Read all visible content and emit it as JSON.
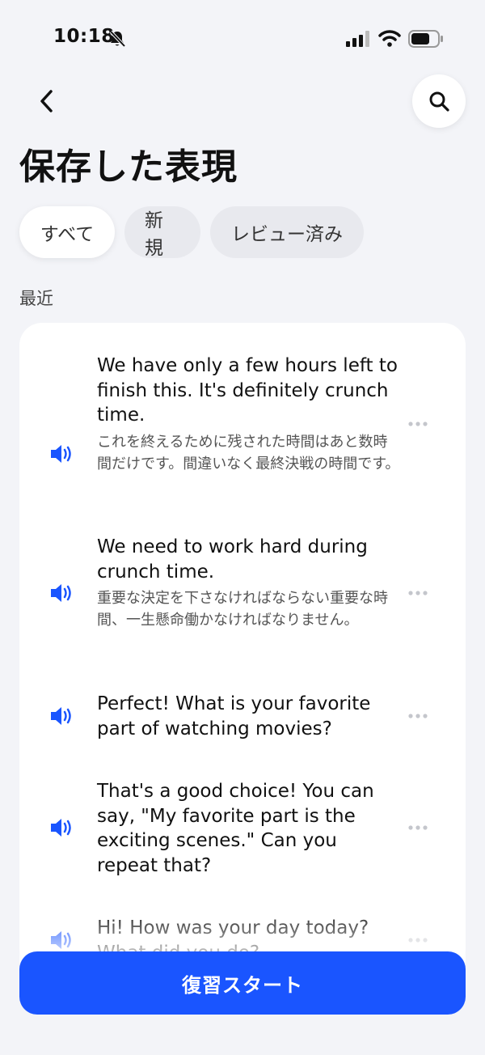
{
  "status_bar": {
    "time": "10:18"
  },
  "header": {
    "title": "保存した表現"
  },
  "tabs": [
    {
      "label": "すべて",
      "active": true
    },
    {
      "label": "新規",
      "active": false
    },
    {
      "label": "レビュー済み",
      "active": false
    }
  ],
  "section": {
    "label": "最近"
  },
  "items": [
    {
      "en": "We have only a few hours left to finish this. It's definitely crunch time.",
      "ja": "これを終えるために残された時間はあと数時間だけです。間違いなく最終決戦の時間です。"
    },
    {
      "en": "We need to work hard during crunch time.",
      "ja": "重要な決定を下さなければならない重要な時間、一生懸命働かなければなりません。"
    },
    {
      "en": "Perfect! What is your favorite part of watching movies?",
      "ja": ""
    },
    {
      "en": "That's a good choice! You can say, \"My favorite part is the exciting scenes.\" Can you repeat that?",
      "ja": ""
    },
    {
      "en": "Hi! How was your day today? What did you do?",
      "ja": ""
    }
  ],
  "cta": {
    "label": "復習スタート"
  },
  "colors": {
    "accent": "#1a55ff",
    "background": "#f3f4f8",
    "card": "#ffffff"
  },
  "icons": [
    "bell-slash-icon",
    "signal-icon",
    "wifi-icon",
    "battery-icon",
    "back-chevron-icon",
    "search-icon",
    "speaker-icon",
    "more-dots-icon"
  ]
}
